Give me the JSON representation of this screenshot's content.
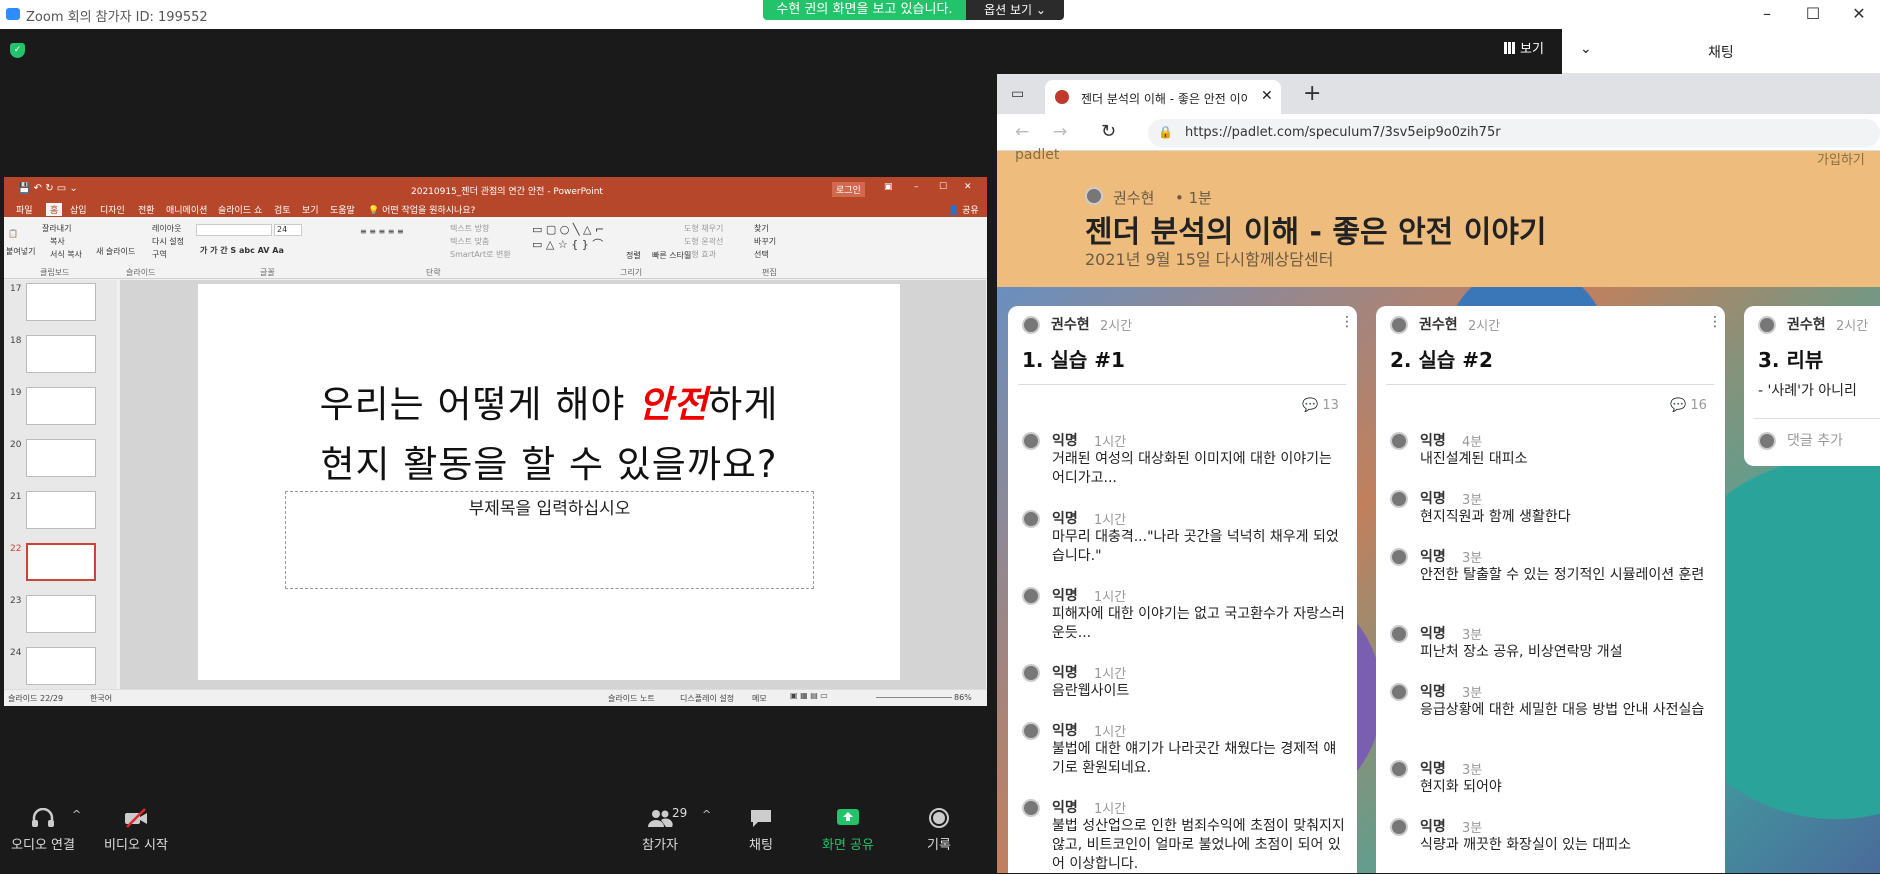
{
  "window": {
    "title": "Zoom 회의 참가자 ID: 199552"
  },
  "share": {
    "banner": "수현 귄의 화면을 보고 있습니다.",
    "view_options": "옵션 보기 ⌄"
  },
  "top_controls": {
    "view_label": "보기"
  },
  "chat_panel": {
    "title": "채팅",
    "collapse": "⌄"
  },
  "ppt": {
    "title": "20210915_젠더 관점의 연간 안전  -  PowerPoint",
    "login": "로그인",
    "share": "공유",
    "tabs": [
      "파일",
      "홈",
      "삽입",
      "디자인",
      "전환",
      "애니메이션",
      "슬라이드 쇼",
      "검토",
      "보기",
      "도움말"
    ],
    "tell_me": "어떤 작업을 원하시나요?",
    "ribbon": {
      "paste": "붙여넣기",
      "cut": "잘라내기",
      "copy": "복사",
      "format_painter": "서식 복사",
      "new_slide": "새 슬라이드",
      "layout": "레이아웃",
      "reset": "다시 설정",
      "section": "구역",
      "font_size": "24",
      "text_dir": "텍스트 방향",
      "align_text": "텍스트 맞춤",
      "smartart": "SmartArt로 변환",
      "arrange": "정렬",
      "quick_styles": "빠른 스타일",
      "shape_fill": "도형 채우기",
      "shape_outline": "도형 윤곽선",
      "shape_effects": "도형 효과",
      "find": "찾기",
      "replace": "바꾸기",
      "select": "선택",
      "groups": [
        "클립보드",
        "슬라이드",
        "글꼴",
        "단락",
        "그리기",
        "편집"
      ]
    },
    "thumb_numbers": [
      "17",
      "18",
      "19",
      "20",
      "21",
      "22",
      "23",
      "24"
    ],
    "slide": {
      "line1_pre": "우리는 어떻게 해야 ",
      "line1_em": "안전",
      "line1_post": "하게",
      "line2": "현지 활동을 할 수 있을까요?",
      "subtitle_placeholder": "부제목을 입력하십시오"
    },
    "status": {
      "slide_count": "슬라이드 22/29",
      "language": "한국어",
      "notes": "슬라이드 노트",
      "display": "디스플레이 설정",
      "comments": "메모",
      "zoom": "86%"
    }
  },
  "browser": {
    "tab_title": "젠더 분석의 이해 - 좋은 안전 이야",
    "url": "https://padlet.com/speculum7/3sv5eip9o0zih75r"
  },
  "padlet": {
    "logo": "padlet",
    "signup": "가입하기",
    "author": "권수현",
    "age": "1분",
    "title": "젠더 분석의 이해 - 좋은 안전 이야기",
    "subtitle": "2021년 9월 15일 다시함께상담센터",
    "columns": [
      {
        "author": "권수현",
        "time": "2시간",
        "title": "1. 실습 #1",
        "comment_count": "13",
        "comments": [
          {
            "name": "익명",
            "time": "1시간",
            "text": "거래된 여성의 대상화된 이미지에 대한 이야기는 어디가고..."
          },
          {
            "name": "익명",
            "time": "1시간",
            "text": "마무리 대충격...\"나라 곳간을 넉넉히 채우게 되었습니다.\""
          },
          {
            "name": "익명",
            "time": "1시간",
            "text": "피해자에 대한 이야기는 없고 국고환수가 자랑스러운듯..."
          },
          {
            "name": "익명",
            "time": "1시간",
            "text": "음란웹사이트"
          },
          {
            "name": "익명",
            "time": "1시간",
            "text": "불법에 대한 얘기가 나라곳간 채웠다는 경제적 얘기로 환원되네요."
          },
          {
            "name": "익명",
            "time": "1시간",
            "text": "불법 성산업으로 인한 범죄수익에 초점이 맞춰지지 않고, 비트코인이 얼마로 불었나에 초점이 되어 있어 이상합니다."
          }
        ]
      },
      {
        "author": "권수현",
        "time": "2시간",
        "title": "2. 실습 #2",
        "comment_count": "16",
        "comments": [
          {
            "name": "익명",
            "time": "4분",
            "text": "내진설계된 대피소"
          },
          {
            "name": "익명",
            "time": "3분",
            "text": "현지직원과 함께 생활한다"
          },
          {
            "name": "익명",
            "time": "3분",
            "text": "안전한 탈출할 수 있는 정기적인 시뮬레이션 훈련"
          },
          {
            "name": "익명",
            "time": "3분",
            "text": "피난처 장소 공유, 비상연락망 개설"
          },
          {
            "name": "익명",
            "time": "3분",
            "text": "응급상황에 대한 세밀한 대응 방법 안내 사전실습"
          },
          {
            "name": "익명",
            "time": "3분",
            "text": "현지화 되어야"
          },
          {
            "name": "익명",
            "time": "3분",
            "text": "식량과 깨끗한 화장실이 있는 대피소"
          }
        ]
      },
      {
        "author": "권수현",
        "time": "2시간",
        "title": "3. 리뷰",
        "preview": "- '사례'가 아니리",
        "add_comment": "댓글 추가"
      }
    ]
  },
  "toolbar": {
    "audio": "오디오 연결",
    "video": "비디오 시작",
    "participants": "참가자",
    "participants_count": "29",
    "chat": "채팅",
    "share": "화면 공유",
    "record": "기록"
  },
  "colors": {
    "zoom_green": "#23c36b",
    "ppt_red": "#b7472a",
    "padlet_header": "#eebd7e"
  }
}
